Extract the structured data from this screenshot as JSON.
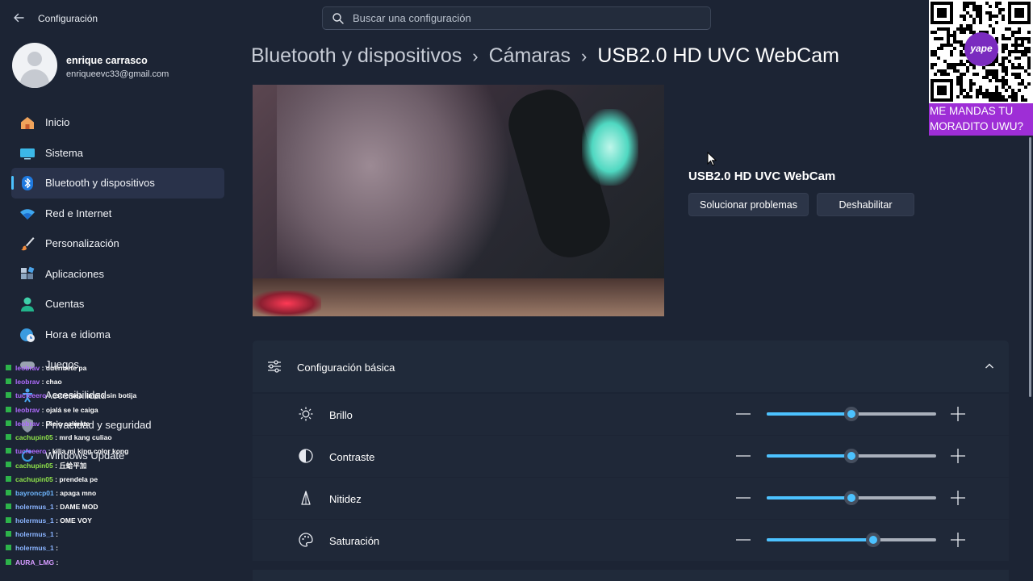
{
  "window": {
    "title": "Configuración"
  },
  "search": {
    "placeholder": "Buscar una configuración"
  },
  "user": {
    "name": "enrique carrasco",
    "email": "enriqueevc33@gmail.com"
  },
  "sidebar": {
    "items": [
      {
        "label": "Inicio",
        "icon": "home-icon"
      },
      {
        "label": "Sistema",
        "icon": "display-icon"
      },
      {
        "label": "Bluetooth y dispositivos",
        "icon": "bluetooth-icon",
        "active": true
      },
      {
        "label": "Red e Internet",
        "icon": "wifi-icon"
      },
      {
        "label": "Personalización",
        "icon": "brush-icon"
      },
      {
        "label": "Aplicaciones",
        "icon": "apps-icon"
      },
      {
        "label": "Cuentas",
        "icon": "person-icon"
      },
      {
        "label": "Hora e idioma",
        "icon": "globe-clock-icon"
      },
      {
        "label": "Juegos",
        "icon": "gamepad-icon"
      },
      {
        "label": "Accesibilidad",
        "icon": "accessibility-icon"
      },
      {
        "label": "Privacidad y seguridad",
        "icon": "shield-icon"
      },
      {
        "label": "Windows Update",
        "icon": "update-icon"
      }
    ]
  },
  "breadcrumb": {
    "items": [
      "Bluetooth y dispositivos",
      "Cámaras"
    ],
    "current": "USB2.0 HD UVC WebCam",
    "separator": "›"
  },
  "device": {
    "name": "USB2.0 HD UVC WebCam",
    "troubleshoot_label": "Solucionar problemas",
    "disable_label": "Deshabilitar"
  },
  "basic_settings": {
    "title": "Configuración básica",
    "rows": [
      {
        "label": "Brillo",
        "icon": "brightness-icon",
        "value": 0.5
      },
      {
        "label": "Contraste",
        "icon": "contrast-icon",
        "value": 0.5
      },
      {
        "label": "Nitidez",
        "icon": "sharpness-icon",
        "value": 0.5
      },
      {
        "label": "Saturación",
        "icon": "palette-icon",
        "value": 0.63
      }
    ]
  },
  "overlay": {
    "promo_line1": "ME MANDAS TU",
    "promo_line2": "MORADITO UWU?",
    "logo_text": "yape"
  },
  "chat": [
    {
      "user": "leobrav",
      "msg": "duérmete pa",
      "color": "#b06cff"
    },
    {
      "user": "leobrav",
      "msg": "chao",
      "color": "#b06cff"
    },
    {
      "user": "tucfeeero",
      "msg": "estremea limpio sin botija",
      "color": "#b06cff"
    },
    {
      "user": "leobrav",
      "msg": "ojalá se le caiga",
      "color": "#b06cff"
    },
    {
      "user": "leobrav",
      "msg": "Pieio calmate",
      "color": "#b06cff"
    },
    {
      "user": "cachupin05",
      "msg": "mrd kang culiao",
      "color": "#8fe34a"
    },
    {
      "user": "tucfeeero",
      "msg": "kilia mi king color kong",
      "color": "#b06cff"
    },
    {
      "user": "cachupin05",
      "msg": "丘蛤平加",
      "color": "#8fe34a"
    },
    {
      "user": "cachupin05",
      "msg": "prendela pe",
      "color": "#8fe34a"
    },
    {
      "user": "bayroncp01",
      "msg": "apaga mno",
      "color": "#6fb7ff"
    },
    {
      "user": "holermus_1",
      "msg": "DAME MOD",
      "color": "#8ab4ff"
    },
    {
      "user": "holermus_1",
      "msg": "OME VOY",
      "color": "#8ab4ff"
    },
    {
      "user": "holermus_1",
      "msg": "",
      "color": "#8ab4ff"
    },
    {
      "user": "holermus_1",
      "msg": "",
      "color": "#8ab4ff"
    },
    {
      "user": "AURA_LMG",
      "msg": "",
      "color": "#d49bff"
    }
  ]
}
